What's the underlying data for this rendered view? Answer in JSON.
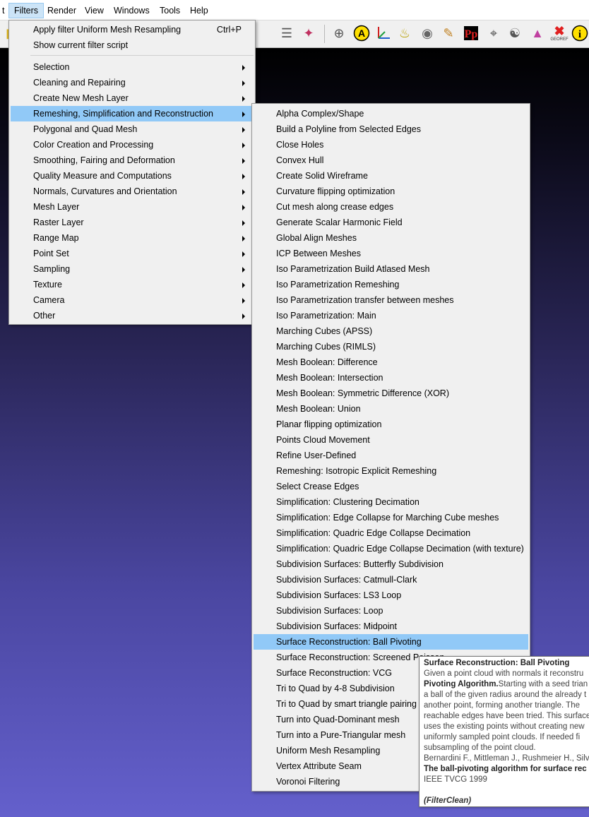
{
  "menubar": {
    "items": [
      "t",
      "Filters",
      "Render",
      "View",
      "Windows",
      "Tools",
      "Help"
    ],
    "active": "Filters"
  },
  "toolbar": {
    "icons": [
      "folder-icon",
      "layers-icon",
      "axes-icon",
      "globe-icon",
      "a-circle-icon",
      "xyz-axes-icon",
      "paint-bucket-icon",
      "camera-icon",
      "brush-icon",
      "pp-icon",
      "pick-points-icon",
      "align-icon",
      "rainbow-icon",
      "georef-icon",
      "info-icon"
    ],
    "georef_label": "GEOREF"
  },
  "filters_menu": {
    "top_items": [
      {
        "label": "Apply filter Uniform Mesh Resampling",
        "shortcut": "Ctrl+P"
      },
      {
        "label": "Show current filter script",
        "shortcut": ""
      }
    ],
    "items": [
      "Selection",
      "Cleaning and Repairing",
      "Create New Mesh Layer",
      "Remeshing, Simplification and Reconstruction",
      "Polygonal and Quad Mesh",
      "Color Creation and Processing",
      "Smoothing, Fairing and Deformation",
      "Quality Measure and Computations",
      "Normals, Curvatures and Orientation",
      "Mesh Layer",
      "Raster Layer",
      "Range Map",
      "Point Set",
      "Sampling",
      "Texture",
      "Camera",
      "Other"
    ],
    "highlighted": "Remeshing, Simplification and Reconstruction"
  },
  "submenu": {
    "items": [
      "Alpha Complex/Shape",
      "Build a Polyline from Selected Edges",
      "Close Holes",
      "Convex Hull",
      "Create Solid Wireframe",
      "Curvature flipping optimization",
      "Cut mesh along crease edges",
      "Generate Scalar Harmonic Field",
      "Global Align Meshes",
      "ICP Between Meshes",
      "Iso Parametrization Build Atlased Mesh",
      "Iso Parametrization Remeshing",
      "Iso Parametrization transfer between meshes",
      "Iso Parametrization: Main",
      "Marching Cubes (APSS)",
      "Marching Cubes (RIMLS)",
      "Mesh Boolean: Difference",
      "Mesh Boolean: Intersection",
      "Mesh Boolean: Symmetric Difference (XOR)",
      "Mesh Boolean: Union",
      "Planar flipping optimization",
      "Points Cloud Movement",
      "Refine User-Defined",
      "Remeshing: Isotropic Explicit Remeshing",
      "Select Crease Edges",
      "Simplification: Clustering Decimation",
      "Simplification: Edge Collapse for Marching Cube meshes",
      "Simplification: Quadric Edge Collapse Decimation",
      "Simplification: Quadric Edge Collapse Decimation (with texture)",
      "Subdivision Surfaces: Butterfly Subdivision",
      "Subdivision Surfaces: Catmull-Clark",
      "Subdivision Surfaces: LS3 Loop",
      "Subdivision Surfaces: Loop",
      "Subdivision Surfaces: Midpoint",
      "Surface Reconstruction: Ball Pivoting",
      "Surface Reconstruction: Screened Poisson",
      "Surface Reconstruction: VCG",
      "Tri to Quad by 4-8 Subdivision",
      "Tri to Quad by smart triangle pairing",
      "Turn into Quad-Dominant mesh",
      "Turn into a Pure-Triangular mesh",
      "Uniform Mesh Resampling",
      "Vertex Attribute Seam",
      "Voronoi Filtering"
    ],
    "highlighted": "Surface Reconstruction: Ball Pivoting"
  },
  "tooltip": {
    "title": "Surface Reconstruction: Ball Pivoting",
    "line1": "Given a point cloud with normals it reconstru",
    "line2_bold": "Pivoting Algorithm.",
    "line2_rest": "Starting with a seed trian",
    "line3": "a ball of the given radius around the already t",
    "line4": "another point, forming another triangle. The",
    "line5": "reachable edges have been tried. This surface",
    "line6": "uses the existing points without creating new",
    "line7": "uniformly sampled point clouds. If needed fi",
    "line8": "subsampling of the point cloud.",
    "line9": "Bernardini F., Mittleman J., Rushmeier H., Silv",
    "line10_bold": "The ball-pivoting algorithm for surface rec",
    "line11": "IEEE TVCG 1999",
    "footer": "(FilterClean)"
  },
  "colors": {
    "highlight": "#91c9f7",
    "menu_bg": "#f0f0f0",
    "viewport_bottom": "#6460cc"
  }
}
